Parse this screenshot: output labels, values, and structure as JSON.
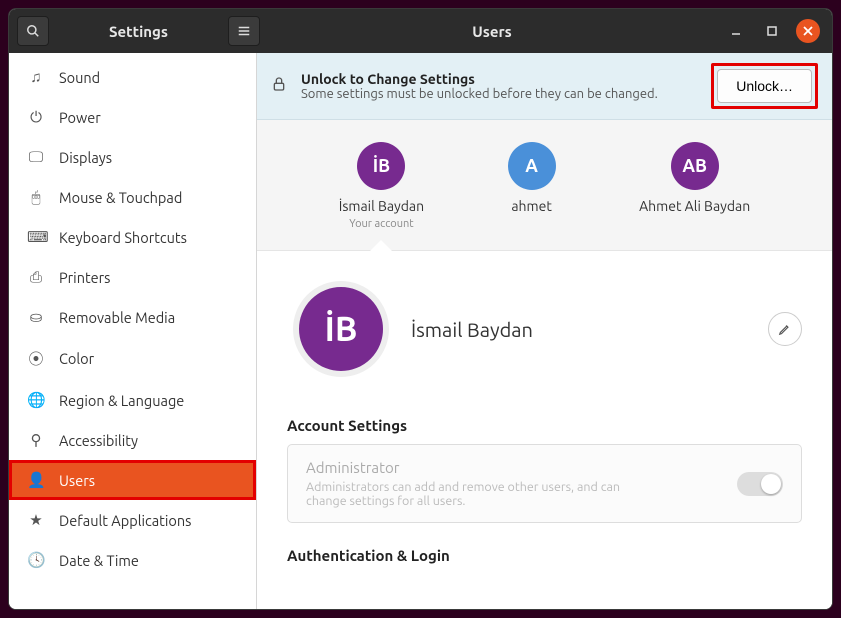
{
  "titlebar": {
    "settings_label": "Settings",
    "page_title": "Users"
  },
  "sidebar": {
    "items": [
      {
        "icon": "♫",
        "label": "Sound"
      },
      {
        "icon": "⏻",
        "label": "Power"
      },
      {
        "icon": "🖵",
        "label": "Displays"
      },
      {
        "icon": "🖱",
        "label": "Mouse & Touchpad"
      },
      {
        "icon": "⌨",
        "label": "Keyboard Shortcuts"
      },
      {
        "icon": "⎙",
        "label": "Printers"
      },
      {
        "icon": "⛀",
        "label": "Removable Media"
      },
      {
        "icon": "⦿",
        "label": "Color"
      },
      {
        "icon": "🌐",
        "label": "Region & Language"
      },
      {
        "icon": "⚲",
        "label": "Accessibility"
      },
      {
        "icon": "👤",
        "label": "Users"
      },
      {
        "icon": "★",
        "label": "Default Applications"
      },
      {
        "icon": "🕓",
        "label": "Date & Time"
      }
    ],
    "selected_index": 10
  },
  "unlock": {
    "title": "Unlock to Change Settings",
    "subtitle": "Some settings must be unlocked before they can be changed.",
    "button": "Unlock…"
  },
  "users": [
    {
      "initials": "İB",
      "name": "İsmail Baydan",
      "sub": "Your account",
      "color": "purple",
      "selected": true
    },
    {
      "initials": "A",
      "name": "ahmet",
      "sub": "",
      "color": "blue",
      "selected": false
    },
    {
      "initials": "AB",
      "name": "Ahmet Ali Baydan",
      "sub": "",
      "color": "purple",
      "selected": false
    }
  ],
  "profile": {
    "initials": "İB",
    "name": "İsmail Baydan"
  },
  "account_settings": {
    "section": "Account Settings",
    "admin_label": "Administrator",
    "admin_desc": "Administrators can add and remove other users, and can change settings for all users."
  },
  "auth": {
    "section": "Authentication & Login"
  }
}
